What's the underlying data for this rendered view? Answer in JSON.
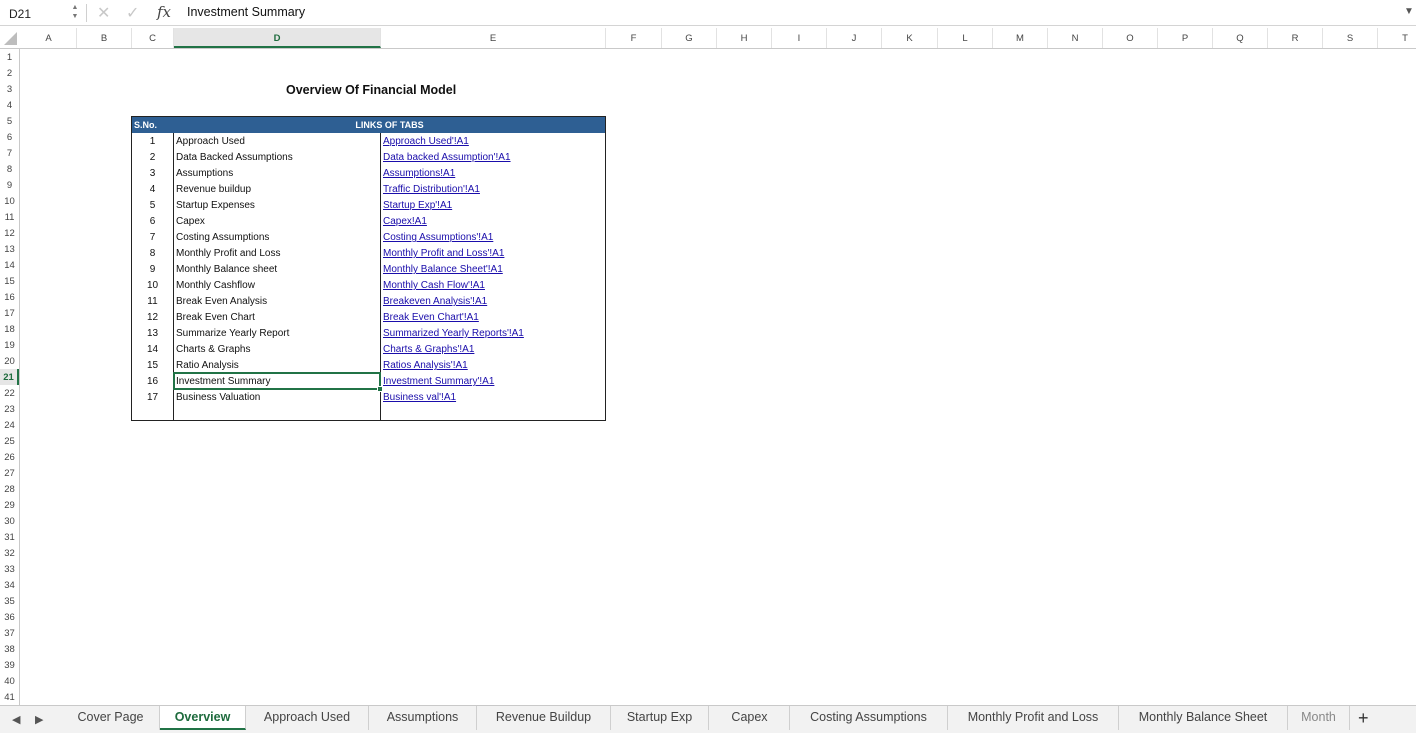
{
  "formula_bar": {
    "cell_ref": "D21",
    "cancel_glyph": "✕",
    "confirm_glyph": "✓",
    "fx_label": "fx",
    "content": "Investment Summary"
  },
  "columns": [
    "A",
    "B",
    "C",
    "D",
    "E",
    "F",
    "G",
    "H",
    "I",
    "J",
    "K",
    "L",
    "M",
    "N",
    "O",
    "P",
    "Q",
    "R",
    "S",
    "T"
  ],
  "selected_column": "D",
  "rows": [
    "1",
    "2",
    "3",
    "4",
    "5",
    "6",
    "7",
    "8",
    "9",
    "10",
    "11",
    "12",
    "13",
    "14",
    "15",
    "16",
    "17",
    "18",
    "19",
    "20",
    "21",
    "22",
    "23",
    "24",
    "25",
    "26",
    "27",
    "28",
    "29",
    "30",
    "31",
    "32",
    "33",
    "34",
    "35",
    "36",
    "37",
    "38",
    "39",
    "40",
    "41"
  ],
  "selected_row": "21",
  "sheet": {
    "title": "Overview Of Financial Model",
    "header_sno": "S.No.",
    "header_links": "LINKS OF TABS",
    "items": [
      {
        "sno": "1",
        "name": "Approach Used",
        "link": "Approach Used'!A1"
      },
      {
        "sno": "2",
        "name": "Data Backed Assumptions",
        "link": "Data backed Assumption'!A1"
      },
      {
        "sno": "3",
        "name": "Assumptions",
        "link": "Assumptions!A1"
      },
      {
        "sno": "4",
        "name": "Revenue buildup",
        "link": "Traffic Distribution'!A1"
      },
      {
        "sno": "5",
        "name": "Startup Expenses",
        "link": "Startup Exp'!A1"
      },
      {
        "sno": "6",
        "name": "Capex",
        "link": "Capex!A1"
      },
      {
        "sno": "7",
        "name": "Costing Assumptions",
        "link": "Costing Assumptions'!A1"
      },
      {
        "sno": "8",
        "name": "Monthly Profit and Loss",
        "link": "Monthly Profit and Loss'!A1"
      },
      {
        "sno": "9",
        "name": "Monthly Balance sheet",
        "link": "Monthly Balance Sheet'!A1"
      },
      {
        "sno": "10",
        "name": "Monthly Cashflow",
        "link": "Monthly Cash Flow'!A1"
      },
      {
        "sno": "11",
        "name": "Break Even Analysis",
        "link": "Breakeven Analysis'!A1"
      },
      {
        "sno": "12",
        "name": "Break Even Chart",
        "link": "Break Even Chart'!A1"
      },
      {
        "sno": "13",
        "name": "Summarize Yearly Report",
        "link": "Summarized Yearly Reports'!A1"
      },
      {
        "sno": "14",
        "name": "Charts & Graphs",
        "link": "Charts & Graphs'!A1"
      },
      {
        "sno": "15",
        "name": "Ratio Analysis",
        "link": "Ratios Analysis'!A1"
      },
      {
        "sno": "16",
        "name": "Investment Summary",
        "link": "Investment Summary'!A1"
      },
      {
        "sno": "17",
        "name": "Business Valuation",
        "link": "Business val'!A1"
      }
    ]
  },
  "tabs": [
    {
      "label": "Cover Page",
      "active": false
    },
    {
      "label": "Overview",
      "active": true
    },
    {
      "label": "Approach Used",
      "active": false
    },
    {
      "label": "Assumptions",
      "active": false
    },
    {
      "label": "Revenue Buildup",
      "active": false
    },
    {
      "label": "Startup Exp",
      "active": false
    },
    {
      "label": "Capex",
      "active": false
    },
    {
      "label": "Costing Assumptions",
      "active": false
    },
    {
      "label": "Monthly Profit and Loss",
      "active": false
    },
    {
      "label": "Monthly Balance Sheet",
      "active": false
    },
    {
      "label": "Month",
      "active": false
    }
  ],
  "tab_nav": {
    "prev": "◀",
    "next": "▶",
    "add": "+"
  },
  "colors": {
    "accent": "#217346",
    "table_header": "#2e5f93",
    "link": "#1a0dab"
  }
}
